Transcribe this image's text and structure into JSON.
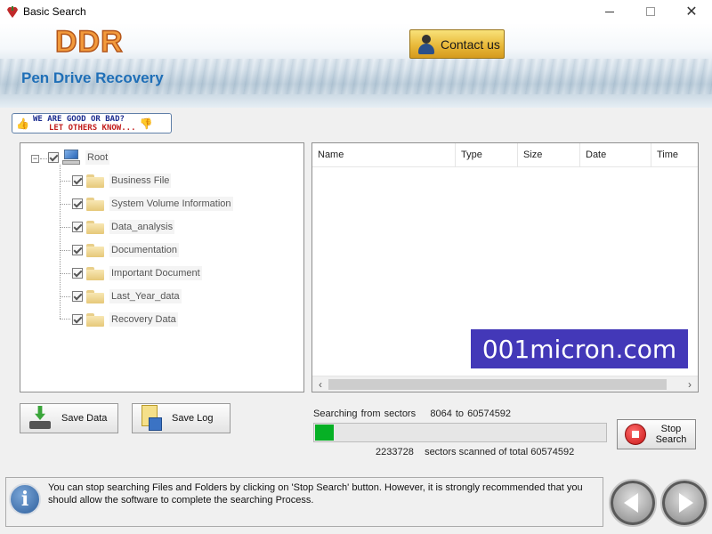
{
  "window": {
    "title": "Basic Search",
    "controls": {
      "minimize": "minimize",
      "maximize": "maximize",
      "close": "✕"
    }
  },
  "header": {
    "brand": "DDR",
    "subtitle": "Pen Drive Recovery",
    "contact_label": "Contact us"
  },
  "feedback": {
    "line1": "WE ARE GOOD OR BAD?",
    "line2": "LET OTHERS KNOW..."
  },
  "tree": {
    "root": {
      "label": "Root",
      "checked": true,
      "expanded": true
    },
    "items": [
      {
        "label": "Business File",
        "checked": true
      },
      {
        "label": "System Volume Information",
        "checked": true
      },
      {
        "label": "Data_analysis",
        "checked": true
      },
      {
        "label": "Documentation",
        "checked": true
      },
      {
        "label": "Important Document",
        "checked": true
      },
      {
        "label": "Last_Year_data",
        "checked": true
      },
      {
        "label": "Recovery Data",
        "checked": true
      }
    ]
  },
  "list": {
    "columns": [
      "Name",
      "Type",
      "Size",
      "Date",
      "Time"
    ],
    "rows": []
  },
  "watermark": "001micron.com",
  "actions": {
    "save_data": "Save Data",
    "save_log": "Save Log"
  },
  "search": {
    "status_prefix": "Searching from sectors",
    "range": "8064 to 60574592",
    "scanned": "2233728",
    "scanned_suffix": "sectors scanned of total 60574592",
    "progress_fraction": 0.04
  },
  "stop_button": {
    "line1": "Stop",
    "line2": "Search"
  },
  "info": {
    "text": "You can stop searching Files and Folders by clicking on 'Stop Search' button. However, it is strongly recommended that you should allow the software to complete the searching Process."
  },
  "colors": {
    "accent": "#1f6fb7",
    "progress": "#06b025",
    "watermark_bg": "#4338b8"
  }
}
